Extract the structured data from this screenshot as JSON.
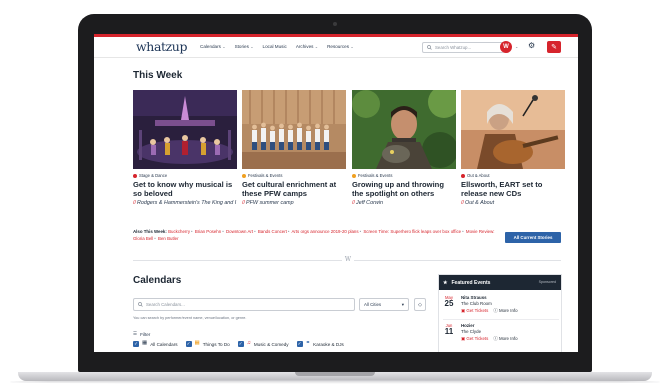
{
  "site": {
    "logo": "whatzup"
  },
  "nav": {
    "links": [
      "Calendars",
      "Stories",
      "Local Music",
      "Archives",
      "Resources"
    ],
    "search_placeholder": "Search Whatzup...",
    "avatar_initial": "W"
  },
  "this_week": {
    "title": "This Week",
    "cards": [
      {
        "category": "Stage & Dance",
        "dot": "#d6242c",
        "headline": "Get to know why musical is so beloved",
        "byline": "Rodgers & Hammerstein's The King and I"
      },
      {
        "category": "Festivals & Events",
        "dot": "#f0a020",
        "headline": "Get cultural enrichment at these PFW camps",
        "byline": "PFW summer camp"
      },
      {
        "category": "Festivals & Events",
        "dot": "#f0a020",
        "headline": "Growing up and throwing the spotlight on others",
        "byline": "Jeff Corwin"
      },
      {
        "category": "Out & About",
        "dot": "#d6242c",
        "headline": "Ellsworth, EART set to release new CDs",
        "byline": "Out & About"
      }
    ],
    "also_label": "Also This Week:",
    "also_links": [
      "Buckcherry",
      "Brian Posehn",
      "Downtown Art",
      "Bands Concert",
      "Arts orgs announce 2019-20 plans",
      "Screen Time: Superhero flick leaps over box office",
      "Movie Review: Gloria Bell",
      "Ben Butler"
    ],
    "all_stories_label": "All Current Stories",
    "divider_mark": "W"
  },
  "calendars": {
    "title": "Calendars",
    "search_placeholder": "Search Calendars...",
    "city_select": "All Cities",
    "hint": "You can search by performer/event name, venue/location, or genre.",
    "filter_label": "Filter",
    "filters": [
      {
        "label": "All Calendars",
        "icon": "calendar-icon"
      },
      {
        "label": "Things To Do",
        "icon": "calendar-icon"
      },
      {
        "label": "Music & Comedy",
        "icon": "music-note-icon"
      },
      {
        "label": "Karaoke & DJs",
        "icon": "microphone-icon"
      }
    ]
  },
  "featured": {
    "title": "Featured Events",
    "sponsored": "Sponsored",
    "events": [
      {
        "month": "May",
        "day": "25",
        "name": "Nita Strauss",
        "venue": "The Club Room",
        "tickets": "Get Tickets",
        "more": "More Info"
      },
      {
        "month": "Jun",
        "day": "11",
        "name": "Hozier",
        "venue": "The Clyde",
        "tickets": "Get Tickets",
        "more": "More Info"
      }
    ]
  },
  "colors": {
    "brand_red": "#d6242c",
    "brand_navy": "#1d3557",
    "button_blue": "#2d63a8"
  }
}
